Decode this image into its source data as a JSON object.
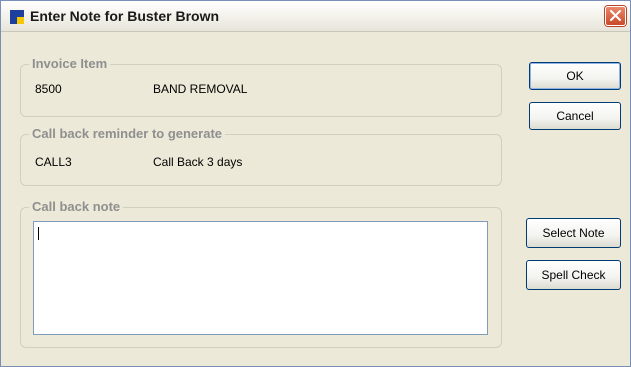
{
  "window": {
    "title": "Enter Note for Buster Brown"
  },
  "invoice_item": {
    "legend": "Invoice Item",
    "code": "8500",
    "description": "BAND REMOVAL"
  },
  "reminder": {
    "legend": "Call back reminder to generate",
    "code": "CALL3",
    "description": "Call Back 3 days"
  },
  "note": {
    "legend": "Call back note",
    "value": ""
  },
  "buttons": {
    "ok": "OK",
    "cancel": "Cancel",
    "select_note": "Select Note",
    "spell_check": "Spell Check"
  },
  "icons": {
    "app": "app-icon",
    "close": "close-icon"
  }
}
